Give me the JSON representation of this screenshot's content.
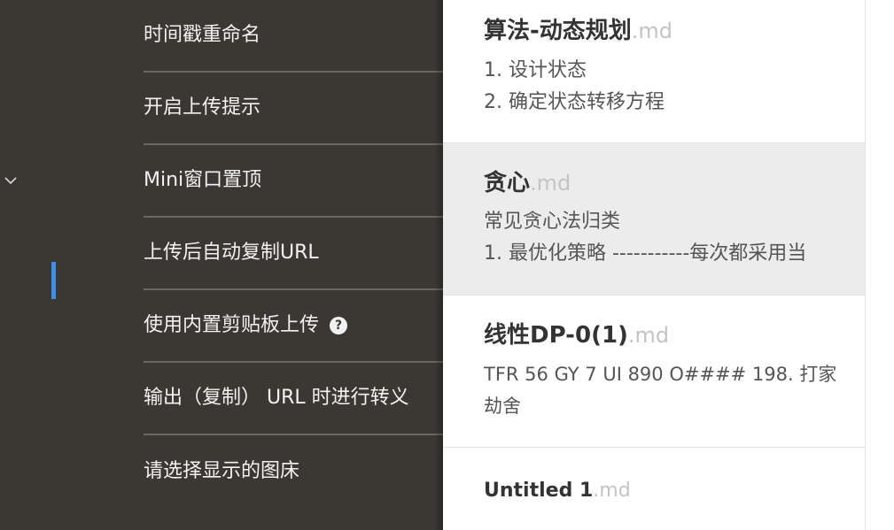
{
  "settings": {
    "items": [
      {
        "label": "时间戳重命名"
      },
      {
        "label": "开启上传提示"
      },
      {
        "label": "Mini窗口置顶"
      },
      {
        "label": "上传后自动复制URL"
      },
      {
        "label": "使用内置剪贴板上传",
        "help_icon": "question-circle-icon",
        "help_glyph": "?"
      },
      {
        "label": "输出（复制） URL 时进行转义"
      },
      {
        "label": "请选择显示的图床"
      }
    ],
    "collapse_icon": "chevron-down-icon"
  },
  "colors": {
    "panel_bg": "#3b3834",
    "accent": "#3d8fea",
    "selected_bg": "#ececec",
    "extension": "#c4c4c4"
  },
  "files": [
    {
      "name": "算法-动态规划",
      "ext": ".md",
      "excerpt": [
        "1. 设计状态",
        "2. 确定状态转移方程"
      ],
      "selected": false
    },
    {
      "name": "贪心",
      "ext": ".md",
      "excerpt": [
        "常见贪心法归类",
        "1. 最优化策略 -----------每次都采用当"
      ],
      "selected": true
    },
    {
      "name": "线性DP-0(1)",
      "ext": ".md",
      "excerpt": [
        "TFR 56 GY 7 UI 890 O#### 198. 打家劫舍"
      ],
      "selected": false
    },
    {
      "name": "Untitled 1",
      "ext": ".md",
      "excerpt": [],
      "selected": false
    }
  ]
}
